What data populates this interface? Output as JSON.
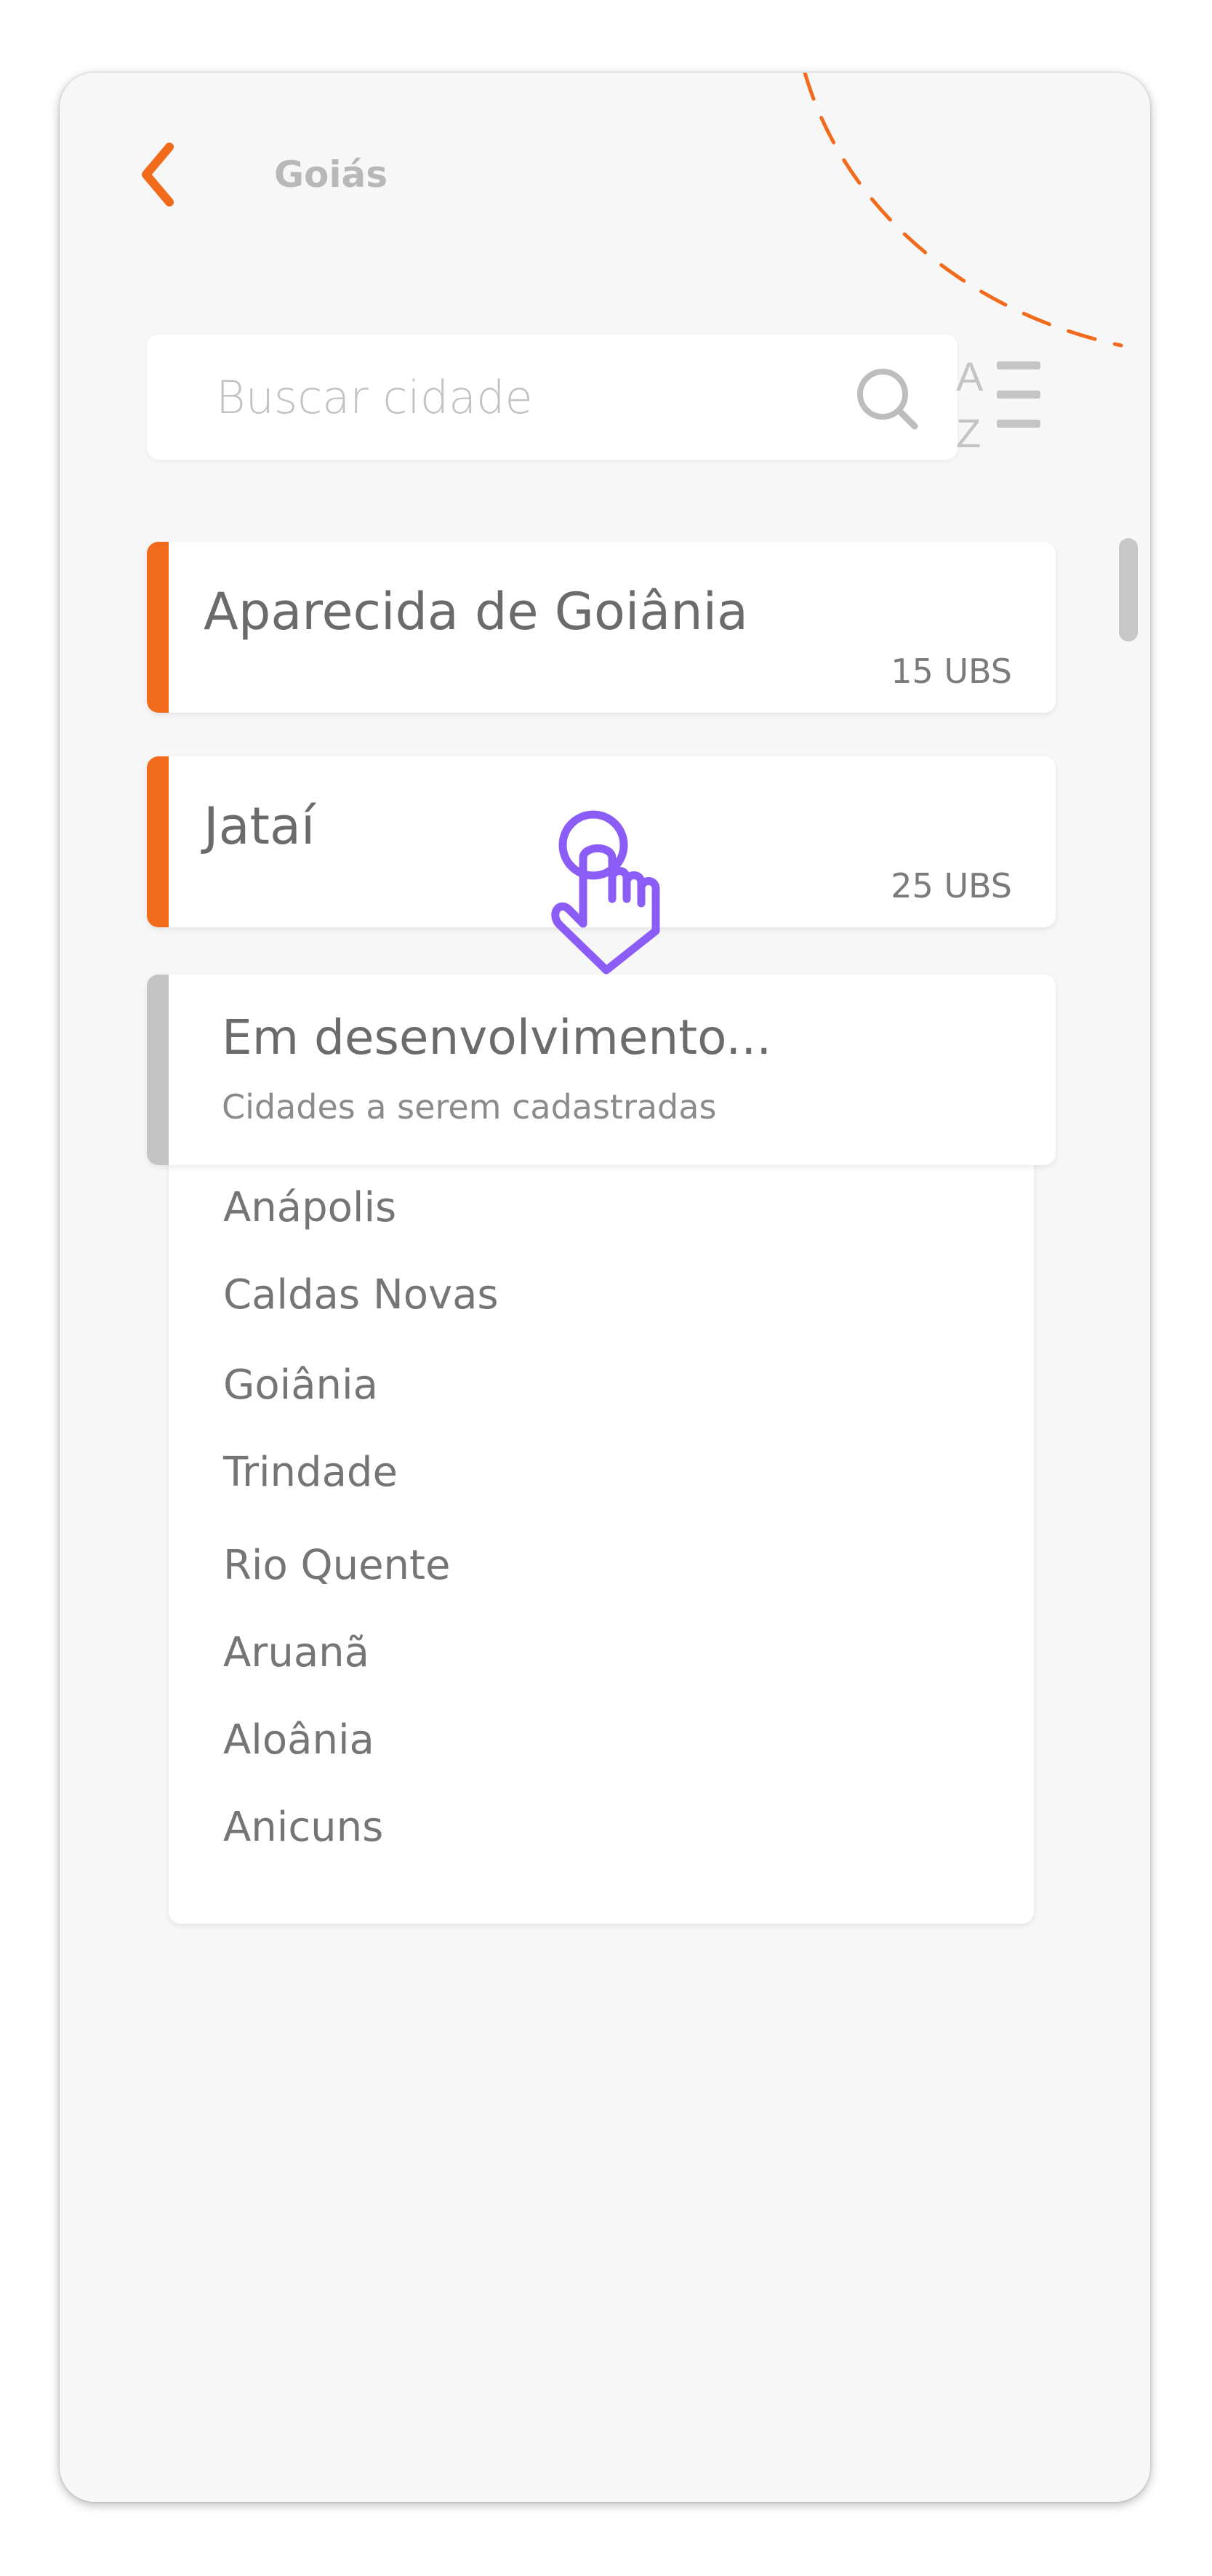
{
  "header": {
    "title": "Goiás",
    "back_icon": "chevron-left-icon"
  },
  "search": {
    "placeholder": "Buscar cidade",
    "value": "",
    "icon": "search-icon"
  },
  "sort": {
    "icon": "sort-alphabetical-icon",
    "letter_top": "A",
    "letter_bottom": "Z"
  },
  "cities": [
    {
      "name": "Aparecida de Goiânia",
      "ubs": "15 UBS"
    },
    {
      "name": "Jataí",
      "ubs": "25 UBS"
    }
  ],
  "in_development": {
    "title": "Em desenvolvimento...",
    "subtitle": "Cidades a serem cadastradas",
    "items": [
      "Anápolis",
      "Caldas Novas",
      "Goiânia",
      "Trindade",
      "Rio Quente",
      "Aruanã",
      "Aloânia",
      "Anicuns"
    ]
  },
  "colors": {
    "accent": "#f26b1d",
    "cursor": "#8b5cf6",
    "muted": "#c4c4c4"
  },
  "overlay": {
    "cursor_icon": "tap-hand-icon"
  }
}
